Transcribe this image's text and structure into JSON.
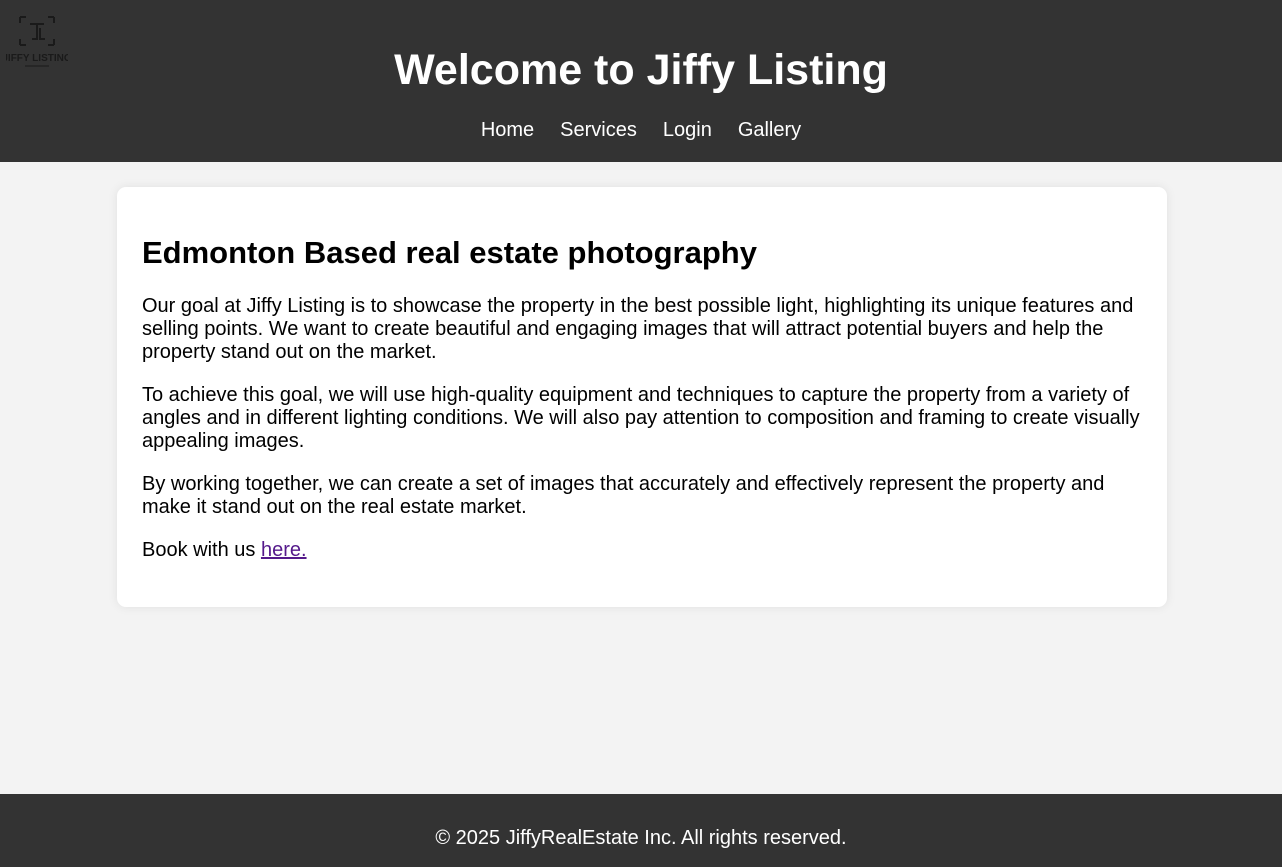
{
  "header": {
    "logo_text": "JIFFY LISTING",
    "title": "Welcome to Jiffy Listing",
    "nav": [
      {
        "label": "Home"
      },
      {
        "label": "Services"
      },
      {
        "label": "Login"
      },
      {
        "label": "Gallery"
      }
    ]
  },
  "main": {
    "heading": "Edmonton Based real estate photography",
    "paragraphs": [
      "Our goal at Jiffy Listing is to showcase the property in the best possible light, highlighting its unique features and selling points. We want to create beautiful and engaging images that will attract potential buyers and help the property stand out on the market.",
      "To achieve this goal, we will use high-quality equipment and techniques to capture the property from a variety of angles and in different lighting conditions. We will also pay attention to composition and framing to create visually appealing images.",
      "By working together, we can create a set of images that accurately and effectively represent the property and make it stand out on the real estate market."
    ],
    "booking_prefix": "Book with us ",
    "booking_link": "here."
  },
  "footer": {
    "copyright": "© 2025 JiffyRealEstate Inc. All rights reserved."
  },
  "colors": {
    "header_bg": "#333333",
    "page_bg": "#f3f3f3",
    "card_bg": "#ffffff",
    "link_visited": "#551a8b"
  },
  "icons": {
    "logo": "jiffy-listing-logo-icon"
  }
}
